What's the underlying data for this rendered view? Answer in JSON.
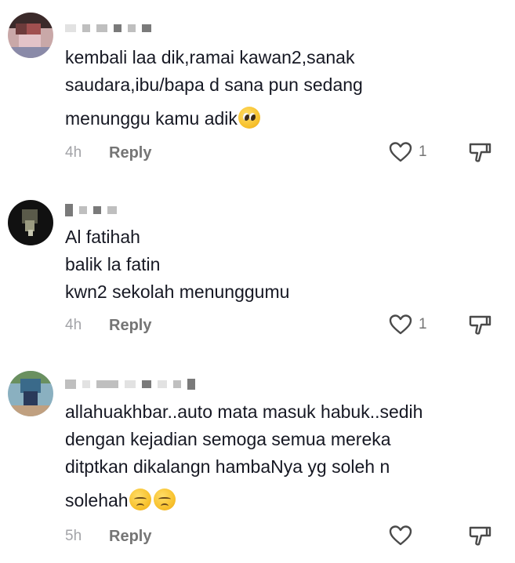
{
  "comments": [
    {
      "lines": [
        "kembali laa dik,ramai kawan2,sanak",
        "saudara,ibu/bapa d sana pun sedang",
        "menunggu kamu adik"
      ],
      "emoji": "pleading-face",
      "time": "4h",
      "reply_label": "Reply",
      "likes": "1"
    },
    {
      "lines": [
        "Al fatihah",
        "balik la fatin",
        "kwn2 sekolah menunggumu"
      ],
      "time": "4h",
      "reply_label": "Reply",
      "likes": "1"
    },
    {
      "lines": [
        "allahuakhbar..auto mata masuk habuk..sedih",
        "dengan kejadian semoga semua mereka",
        "ditptkan dikalangn hambaNya yg soleh n",
        "solehah"
      ],
      "emoji": "disappointed-face x2",
      "time": "5h",
      "reply_label": "Reply",
      "likes": ""
    }
  ],
  "colors": {
    "text": "#161823",
    "muted": "#a3a4a8",
    "reply": "#757575",
    "icon": "#4a4a4a"
  }
}
